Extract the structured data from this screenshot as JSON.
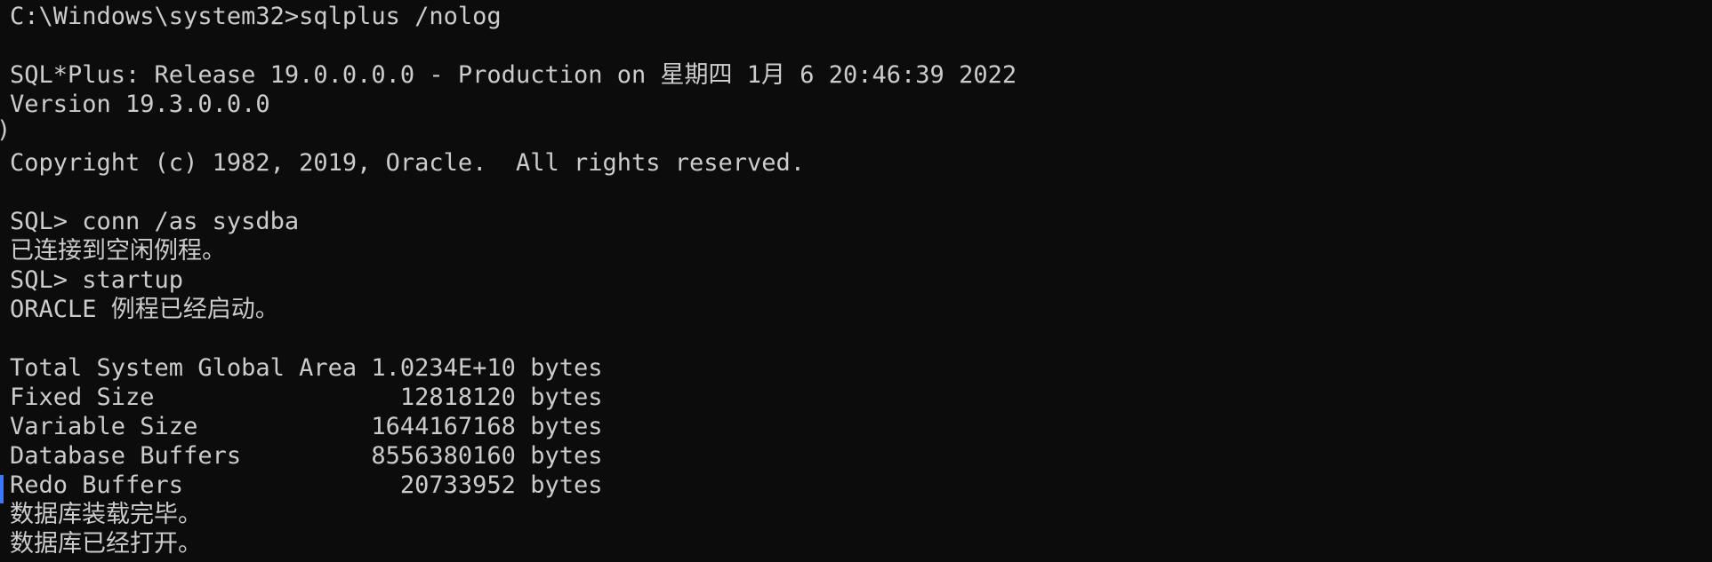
{
  "console": {
    "lines": [
      "C:\\Windows\\system32>sqlplus /nolog",
      "",
      "SQL*Plus: Release 19.0.0.0.0 - Production on 星期四 1月 6 20:46:39 2022",
      "Version 19.3.0.0.0",
      "",
      "Copyright (c) 1982, 2019, Oracle.  All rights reserved.",
      "",
      "SQL> conn /as sysdba",
      "已连接到空闲例程。",
      "SQL> startup",
      "ORACLE 例程已经启动。",
      "",
      "Total System Global Area 1.0234E+10 bytes",
      "Fixed Size                 12818120 bytes",
      "Variable Size            1644167168 bytes",
      "Database Buffers         8556380160 bytes",
      "Redo Buffers               20733952 bytes",
      "数据库装载完毕。",
      "数据库已经打开。"
    ],
    "edge_glyph": ")"
  },
  "colors": {
    "background": "#0c0c0c",
    "foreground": "#cccccc",
    "marker": "#3b78ff"
  }
}
